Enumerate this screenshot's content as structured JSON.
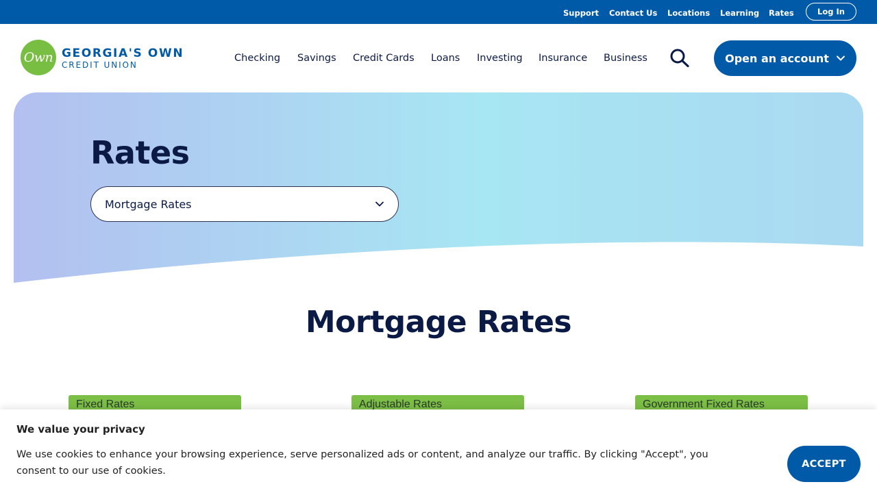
{
  "utility_nav": {
    "support": "Support",
    "contact_us": "Contact Us",
    "locations": "Locations",
    "learning": "Learning",
    "rates": "Rates",
    "login": "Log In"
  },
  "logo": {
    "mark": "Own",
    "line1": "GEORGIA'S OWN",
    "line2": "CREDIT UNION"
  },
  "main_nav": {
    "items": [
      "Checking",
      "Savings",
      "Credit Cards",
      "Loans",
      "Investing",
      "Insurance",
      "Business"
    ],
    "cta": "Open an account"
  },
  "hero": {
    "title": "Rates",
    "select_value": "Mortgage Rates"
  },
  "section": {
    "title": "Mortgage Rates",
    "tabs": [
      "Fixed Rates",
      "Adjustable Rates",
      "Government Fixed Rates"
    ]
  },
  "cookie_banner": {
    "title": "We value your privacy",
    "text": "We use cookies to enhance your browsing experience, serve personalized ads or content, and analyze our traffic. By clicking \"Accept\", you consent to our use of cookies.",
    "accept": "ACCEPT"
  },
  "colors": {
    "brand_blue": "#005aa7",
    "brand_green": "#78be43",
    "navy_text": "#0b1a45"
  },
  "icons": [
    "search-icon",
    "chevron-down-icon"
  ]
}
